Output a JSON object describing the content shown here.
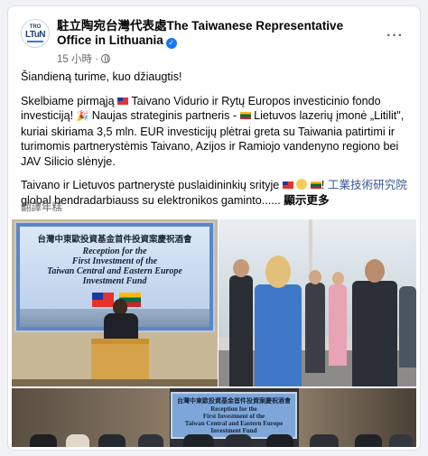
{
  "post": {
    "page_name": "駐立陶宛台灣代表處The Taiwanese Representative Office in Lithuania",
    "timestamp": "15 小時",
    "separator": "·",
    "verified_mark": "✓",
    "more_label": "···",
    "avatar_text_top": "TRO",
    "avatar_text_main": "LTuN"
  },
  "content": {
    "line1": "Šiandieną turime, kuo džiaugtis!",
    "p2_part1": "Skelbiame pirmąją",
    "p2_part2": "Taivano Vidurio ir Rytų Europos investicinio fondo investiciją!",
    "p2_part3": "Naujas strateginis partneris -",
    "p2_part4": "Lietuvos lazerių įmonė „Litilit\", kuriai skiriama 3,5 mln. EUR investicijų plėtrai greta su Taiwania patirtimi ir turimomis partnerystėmis Taivano, Azijos ir Ramiojo vandenyno regiono bei JAV Silicio slėnyje.",
    "p3_part1": "Taivano ir Lietuvos partnerystė puslaidininkių srityje",
    "p3_part2": "!",
    "p3_link": "工業技術研究院",
    "p3_part3": "global bendradarbiauss su elektronikos gaminto......",
    "see_more": "顯示更多",
    "translate": "翻譯年糕"
  },
  "photo_main": {
    "screen_zh": "台灣中東歐投資基金首件投資案慶祝酒會",
    "screen_en_1": "Reception for the",
    "screen_en_2": "First Investment of the",
    "screen_en_3": "Taiwan Central and Eastern Europe",
    "screen_en_4": "Investment Fund"
  },
  "photo_bottom": {
    "screen_zh": "台灣中東歐投資基金首件投資案慶祝酒會",
    "screen_en_1": "Reception for the",
    "screen_en_2": "First Investment of the",
    "screen_en_3": "Taiwan Central and Eastern Europe",
    "screen_en_4": "Investment Fund"
  },
  "colors": {
    "link": "#385898",
    "verified": "#1877f2",
    "meta": "#65676b"
  }
}
